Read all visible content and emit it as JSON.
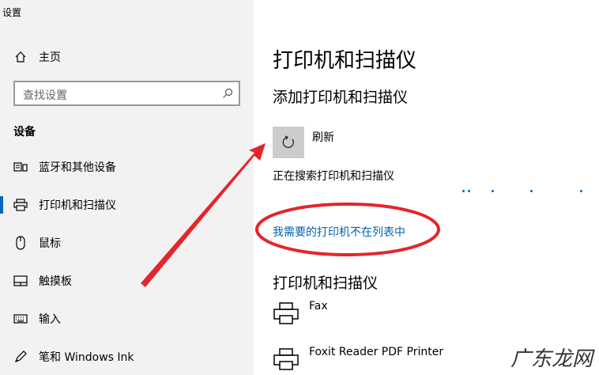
{
  "window": {
    "title": "设置"
  },
  "sidebar": {
    "home_label": "主页",
    "search_placeholder": "查找设置",
    "section_heading": "设备",
    "items": [
      {
        "label": "蓝牙和其他设备",
        "icon": "bluetooth-devices-icon"
      },
      {
        "label": "打印机和扫描仪",
        "icon": "printer-icon",
        "active": true
      },
      {
        "label": "鼠标",
        "icon": "mouse-icon"
      },
      {
        "label": "触摸板",
        "icon": "touchpad-icon"
      },
      {
        "label": "输入",
        "icon": "keyboard-icon"
      },
      {
        "label": "笔和 Windows Ink",
        "icon": "pen-icon"
      }
    ]
  },
  "main": {
    "title": "打印机和扫描仪",
    "add_heading": "添加打印机和扫描仪",
    "refresh_label": "刷新",
    "searching_text": "正在搜索打印机和扫描仪",
    "not_listed_link": "我需要的打印机不在列表中",
    "printers_heading": "打印机和扫描仪",
    "printers": [
      {
        "name": "Fax"
      },
      {
        "name": "Foxit Reader PDF Printer"
      }
    ]
  },
  "colors": {
    "accent": "#0067c0",
    "annotation": "#e4252c"
  },
  "watermark": "广东龙网"
}
